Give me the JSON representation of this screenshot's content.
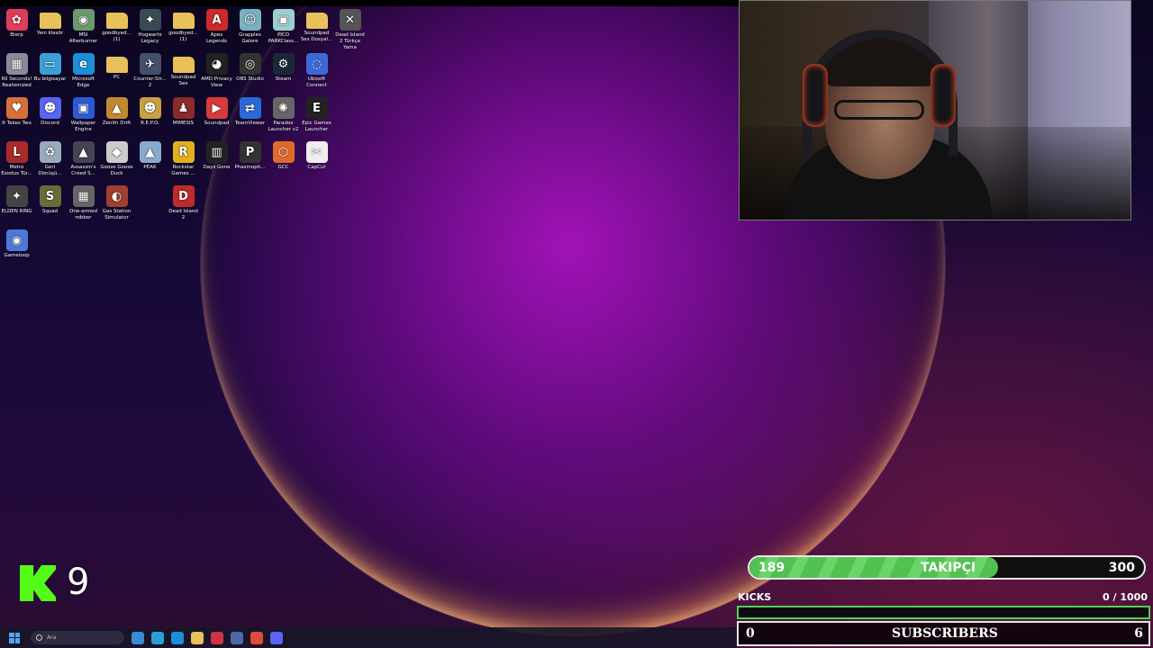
{
  "desktop": {
    "icons": [
      {
        "label": "Blerp",
        "col": 0,
        "row": 0,
        "color": "#e03d5a",
        "glyph": "✿"
      },
      {
        "label": "Yeni klasör",
        "col": 1,
        "row": 0,
        "color": "#e8c15a",
        "glyph": ""
      },
      {
        "label": "MSI Afterburner",
        "col": 2,
        "row": 0,
        "color": "#6a9a6a",
        "glyph": "◉"
      },
      {
        "label": "goodbyed... (1)",
        "col": 3,
        "row": 0,
        "color": "#e8c15a",
        "glyph": ""
      },
      {
        "label": "Hogwarts Legacy",
        "col": 4,
        "row": 0,
        "color": "#3a4a55",
        "glyph": "✦"
      },
      {
        "label": "goodbyed... (1)",
        "col": 5,
        "row": 0,
        "color": "#e8c15a",
        "glyph": ""
      },
      {
        "label": "Apex Legends",
        "col": 6,
        "row": 0,
        "color": "#cc2a2a",
        "glyph": "A"
      },
      {
        "label": "Grapples Galore",
        "col": 7,
        "row": 0,
        "color": "#7ab0c0",
        "glyph": "☺"
      },
      {
        "label": "PICO PARKClass...",
        "col": 8,
        "row": 0,
        "color": "#9ad0d0",
        "glyph": "▣"
      },
      {
        "label": "Soundpad Ses Dosyal...",
        "col": 9,
        "row": 0,
        "color": "#e8c15a",
        "glyph": ""
      },
      {
        "label": "Dead Island 2 Türkçe Yama",
        "col": 10,
        "row": 0,
        "color": "#555",
        "glyph": "✕"
      },
      {
        "label": "60 Seconds! Reatomized",
        "col": 0,
        "row": 1,
        "color": "#8a8a99",
        "glyph": "▦"
      },
      {
        "label": "Bu bilgisayar",
        "col": 1,
        "row": 1,
        "color": "#3aa0d8",
        "glyph": "▭"
      },
      {
        "label": "Microsoft Edge",
        "col": 2,
        "row": 1,
        "color": "#1b8fd8",
        "glyph": "e"
      },
      {
        "label": "PC",
        "col": 3,
        "row": 1,
        "color": "#e8c15a",
        "glyph": ""
      },
      {
        "label": "Counter-Str... 2",
        "col": 4,
        "row": 1,
        "color": "#44506a",
        "glyph": "✈"
      },
      {
        "label": "Soundpad Ses",
        "col": 5,
        "row": 1,
        "color": "#e8c15a",
        "glyph": ""
      },
      {
        "label": "AMD Privacy View",
        "col": 6,
        "row": 1,
        "color": "#222",
        "glyph": "◕"
      },
      {
        "label": "OBS Studio",
        "col": 7,
        "row": 1,
        "color": "#333",
        "glyph": "◎"
      },
      {
        "label": "Steam",
        "col": 8,
        "row": 1,
        "color": "#1b2838",
        "glyph": "⚙"
      },
      {
        "label": "Ubisoft Connect",
        "col": 9,
        "row": 1,
        "color": "#3b6ad8",
        "glyph": "◌"
      },
      {
        "label": "It Takes Two",
        "col": 0,
        "row": 2,
        "color": "#d8703a",
        "glyph": "♥"
      },
      {
        "label": "Discord",
        "col": 1,
        "row": 2,
        "color": "#5865f2",
        "glyph": "☻"
      },
      {
        "label": "Wallpaper Engine",
        "col": 2,
        "row": 2,
        "color": "#2a5ad8",
        "glyph": "▣"
      },
      {
        "label": "Zenith Drift",
        "col": 3,
        "row": 2,
        "color": "#c08a30",
        "glyph": "▲"
      },
      {
        "label": "R.E.P.O.",
        "col": 4,
        "row": 2,
        "color": "#c8a040",
        "glyph": "☻"
      },
      {
        "label": "MIMESIS",
        "col": 5,
        "row": 2,
        "color": "#8a2a2a",
        "glyph": "♟"
      },
      {
        "label": "Soundpad",
        "col": 6,
        "row": 2,
        "color": "#d83a3a",
        "glyph": "▶"
      },
      {
        "label": "TeamViewer",
        "col": 7,
        "row": 2,
        "color": "#2a6ad8",
        "glyph": "⇄"
      },
      {
        "label": "Paradox Launcher v2",
        "col": 8,
        "row": 2,
        "color": "#666",
        "glyph": "✺"
      },
      {
        "label": "Epic Games Launcher",
        "col": 9,
        "row": 2,
        "color": "#222",
        "glyph": "E"
      },
      {
        "label": "Metro Exodus Tür...",
        "col": 0,
        "row": 3,
        "color": "#aa2a2a",
        "glyph": "L"
      },
      {
        "label": "Geri Dönüşü...",
        "col": 1,
        "row": 3,
        "color": "#9ab",
        "glyph": "♻"
      },
      {
        "label": "Assassin's Creed S...",
        "col": 2,
        "row": 3,
        "color": "#445",
        "glyph": "▲"
      },
      {
        "label": "Goose Goose Duck",
        "col": 3,
        "row": 3,
        "color": "#ccc",
        "glyph": "◆"
      },
      {
        "label": "PEAK",
        "col": 4,
        "row": 3,
        "color": "#88aacc",
        "glyph": "▲"
      },
      {
        "label": "Rockstar Games ...",
        "col": 5,
        "row": 3,
        "color": "#e0b020",
        "glyph": "R"
      },
      {
        "label": "Days Gone",
        "col": 6,
        "row": 3,
        "color": "#222",
        "glyph": "▥"
      },
      {
        "label": "Phasmoph...",
        "col": 7,
        "row": 3,
        "color": "#333",
        "glyph": "P"
      },
      {
        "label": "GCC",
        "col": 8,
        "row": 3,
        "color": "#e06a2a",
        "glyph": "⬡"
      },
      {
        "label": "CapCut",
        "col": 9,
        "row": 3,
        "color": "#eee",
        "glyph": "✂"
      },
      {
        "label": "ELDEN RING",
        "col": 0,
        "row": 4,
        "color": "#444",
        "glyph": "✦"
      },
      {
        "label": "Squad",
        "col": 1,
        "row": 4,
        "color": "#6a6a3a",
        "glyph": "S"
      },
      {
        "label": "One-armed robber",
        "col": 2,
        "row": 4,
        "color": "#666",
        "glyph": "▦"
      },
      {
        "label": "Gas Station Simulator",
        "col": 3,
        "row": 4,
        "color": "#a04030",
        "glyph": "◐"
      },
      {
        "label": "Dead Island 2",
        "col": 5,
        "row": 4,
        "color": "#c02a2a",
        "glyph": "D"
      },
      {
        "label": "Gameloop",
        "col": 0,
        "row": 5,
        "color": "#4a7ad8",
        "glyph": "◉"
      }
    ]
  },
  "overlay": {
    "kick_count": "9",
    "followers": {
      "current": "189",
      "label": "TAKIPÇI",
      "goal": "300",
      "progress": 0.63
    },
    "kicks": {
      "label": "KICKS",
      "current": "0",
      "goal": "/ 1000"
    },
    "subscribers": {
      "current": "0",
      "label": "SUBSCRIBERS",
      "goal": "6"
    }
  },
  "taskbar": {
    "search_placeholder": "Ara",
    "apps": [
      "#3a8ad8",
      "#2aa0d8",
      "#1b8fd8",
      "#e8c15a",
      "#cc3344",
      "#4a6aa8",
      "#e04a3a",
      "#5865f2"
    ]
  }
}
